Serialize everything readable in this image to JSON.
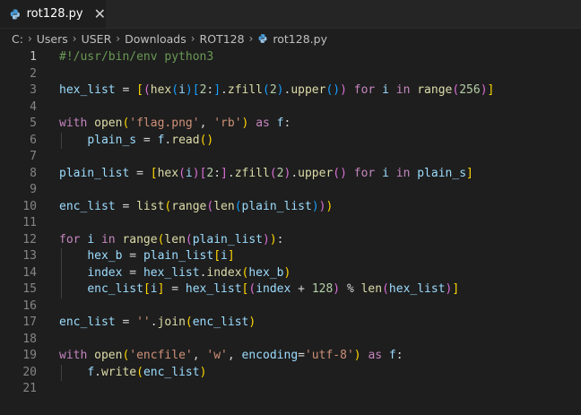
{
  "tab": {
    "filename": "rot128.py",
    "close_glyph": "✕"
  },
  "breadcrumb": [
    "C:",
    "Users",
    "USER",
    "Downloads",
    "ROT128",
    "rot128.py"
  ],
  "editor": {
    "active_line": 1,
    "lines": [
      [
        [
          "c",
          "#!/usr/bin/env python3"
        ]
      ],
      [],
      [
        [
          "v",
          "hex_list"
        ],
        [
          "o",
          " = "
        ],
        [
          "b1",
          "["
        ],
        [
          "b2",
          "("
        ],
        [
          "f",
          "hex"
        ],
        [
          "b3",
          "("
        ],
        [
          "v",
          "i"
        ],
        [
          "b3",
          ")"
        ],
        [
          "b3",
          "["
        ],
        [
          "n",
          "2"
        ],
        [
          "o",
          ":"
        ],
        [
          "b3",
          "]"
        ],
        [
          "o",
          "."
        ],
        [
          "f",
          "zfill"
        ],
        [
          "b3",
          "("
        ],
        [
          "n",
          "2"
        ],
        [
          "b3",
          ")"
        ],
        [
          "o",
          "."
        ],
        [
          "f",
          "upper"
        ],
        [
          "b3",
          "("
        ],
        [
          "b3",
          ")"
        ],
        [
          "b2",
          ")"
        ],
        [
          "o",
          " "
        ],
        [
          "k",
          "for"
        ],
        [
          "o",
          " "
        ],
        [
          "v",
          "i"
        ],
        [
          "o",
          " "
        ],
        [
          "k",
          "in"
        ],
        [
          "o",
          " "
        ],
        [
          "f",
          "range"
        ],
        [
          "b2",
          "("
        ],
        [
          "n",
          "256"
        ],
        [
          "b2",
          ")"
        ],
        [
          "b1",
          "]"
        ]
      ],
      [],
      [
        [
          "k",
          "with"
        ],
        [
          "o",
          " "
        ],
        [
          "f",
          "open"
        ],
        [
          "b1",
          "("
        ],
        [
          "s",
          "'flag.png'"
        ],
        [
          "o",
          ", "
        ],
        [
          "s",
          "'rb'"
        ],
        [
          "b1",
          ")"
        ],
        [
          "o",
          " "
        ],
        [
          "k",
          "as"
        ],
        [
          "o",
          " "
        ],
        [
          "v",
          "f"
        ],
        [
          "o",
          ":"
        ]
      ],
      [
        [
          "o",
          "    "
        ],
        [
          "v",
          "plain_s"
        ],
        [
          "o",
          " = "
        ],
        [
          "v",
          "f"
        ],
        [
          "o",
          "."
        ],
        [
          "f",
          "read"
        ],
        [
          "b1",
          "("
        ],
        [
          "b1",
          ")"
        ]
      ],
      [],
      [
        [
          "v",
          "plain_list"
        ],
        [
          "o",
          " = "
        ],
        [
          "b1",
          "["
        ],
        [
          "f",
          "hex"
        ],
        [
          "b2",
          "("
        ],
        [
          "v",
          "i"
        ],
        [
          "b2",
          ")"
        ],
        [
          "b2",
          "["
        ],
        [
          "n",
          "2"
        ],
        [
          "o",
          ":"
        ],
        [
          "b2",
          "]"
        ],
        [
          "o",
          "."
        ],
        [
          "f",
          "zfill"
        ],
        [
          "b2",
          "("
        ],
        [
          "n",
          "2"
        ],
        [
          "b2",
          ")"
        ],
        [
          "o",
          "."
        ],
        [
          "f",
          "upper"
        ],
        [
          "b2",
          "("
        ],
        [
          "b2",
          ")"
        ],
        [
          "o",
          " "
        ],
        [
          "k",
          "for"
        ],
        [
          "o",
          " "
        ],
        [
          "v",
          "i"
        ],
        [
          "o",
          " "
        ],
        [
          "k",
          "in"
        ],
        [
          "o",
          " "
        ],
        [
          "v",
          "plain_s"
        ],
        [
          "b1",
          "]"
        ]
      ],
      [],
      [
        [
          "v",
          "enc_list"
        ],
        [
          "o",
          " = "
        ],
        [
          "f",
          "list"
        ],
        [
          "b1",
          "("
        ],
        [
          "f",
          "range"
        ],
        [
          "b2",
          "("
        ],
        [
          "f",
          "len"
        ],
        [
          "b3",
          "("
        ],
        [
          "v",
          "plain_list"
        ],
        [
          "b3",
          ")"
        ],
        [
          "b2",
          ")"
        ],
        [
          "b1",
          ")"
        ]
      ],
      [],
      [
        [
          "k",
          "for"
        ],
        [
          "o",
          " "
        ],
        [
          "v",
          "i"
        ],
        [
          "o",
          " "
        ],
        [
          "k",
          "in"
        ],
        [
          "o",
          " "
        ],
        [
          "f",
          "range"
        ],
        [
          "b1",
          "("
        ],
        [
          "f",
          "len"
        ],
        [
          "b2",
          "("
        ],
        [
          "v",
          "plain_list"
        ],
        [
          "b2",
          ")"
        ],
        [
          "b1",
          ")"
        ],
        [
          "o",
          ":"
        ]
      ],
      [
        [
          "o",
          "    "
        ],
        [
          "v",
          "hex_b"
        ],
        [
          "o",
          " = "
        ],
        [
          "v",
          "plain_list"
        ],
        [
          "b1",
          "["
        ],
        [
          "v",
          "i"
        ],
        [
          "b1",
          "]"
        ]
      ],
      [
        [
          "o",
          "    "
        ],
        [
          "v",
          "index"
        ],
        [
          "o",
          " = "
        ],
        [
          "v",
          "hex_list"
        ],
        [
          "o",
          "."
        ],
        [
          "f",
          "index"
        ],
        [
          "b1",
          "("
        ],
        [
          "v",
          "hex_b"
        ],
        [
          "b1",
          ")"
        ]
      ],
      [
        [
          "o",
          "    "
        ],
        [
          "v",
          "enc_list"
        ],
        [
          "b1",
          "["
        ],
        [
          "v",
          "i"
        ],
        [
          "b1",
          "]"
        ],
        [
          "o",
          " = "
        ],
        [
          "v",
          "hex_list"
        ],
        [
          "b1",
          "["
        ],
        [
          "b2",
          "("
        ],
        [
          "v",
          "index"
        ],
        [
          "o",
          " + "
        ],
        [
          "n",
          "128"
        ],
        [
          "b2",
          ")"
        ],
        [
          "o",
          " % "
        ],
        [
          "f",
          "len"
        ],
        [
          "b2",
          "("
        ],
        [
          "v",
          "hex_list"
        ],
        [
          "b2",
          ")"
        ],
        [
          "b1",
          "]"
        ]
      ],
      [],
      [
        [
          "v",
          "enc_list"
        ],
        [
          "o",
          " = "
        ],
        [
          "s",
          "''"
        ],
        [
          "o",
          "."
        ],
        [
          "f",
          "join"
        ],
        [
          "b1",
          "("
        ],
        [
          "v",
          "enc_list"
        ],
        [
          "b1",
          ")"
        ]
      ],
      [],
      [
        [
          "k",
          "with"
        ],
        [
          "o",
          " "
        ],
        [
          "f",
          "open"
        ],
        [
          "b1",
          "("
        ],
        [
          "s",
          "'encfile'"
        ],
        [
          "o",
          ", "
        ],
        [
          "s",
          "'w'"
        ],
        [
          "o",
          ", "
        ],
        [
          "v",
          "encoding"
        ],
        [
          "o",
          "="
        ],
        [
          "s",
          "'utf-8'"
        ],
        [
          "b1",
          ")"
        ],
        [
          "o",
          " "
        ],
        [
          "k",
          "as"
        ],
        [
          "o",
          " "
        ],
        [
          "v",
          "f"
        ],
        [
          "o",
          ":"
        ]
      ],
      [
        [
          "o",
          "    "
        ],
        [
          "v",
          "f"
        ],
        [
          "o",
          "."
        ],
        [
          "f",
          "write"
        ],
        [
          "b1",
          "("
        ],
        [
          "v",
          "enc_list"
        ],
        [
          "b1",
          ")"
        ]
      ],
      []
    ]
  }
}
